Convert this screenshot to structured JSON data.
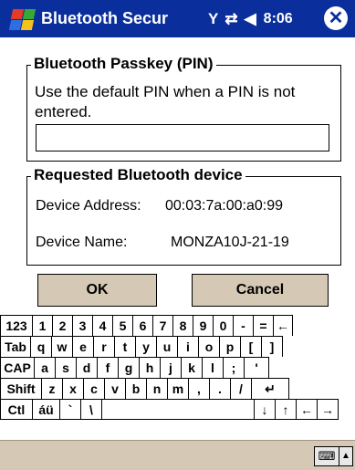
{
  "titlebar": {
    "title": "Bluetooth Secur",
    "status_icons": [
      "signal-icon",
      "connectivity-icon",
      "volume-icon"
    ],
    "signal_glyph": "Y",
    "conn_glyph": "⇄",
    "volume_glyph": "◀",
    "clock": "8:06",
    "close_glyph": "✕"
  },
  "passkey": {
    "legend": "Bluetooth Passkey (PIN)",
    "description": "Use the default PIN when a PIN is not entered.",
    "pin_value": ""
  },
  "device": {
    "legend": "Requested Bluetooth device",
    "address_label": "Device Address:",
    "address_value": "00:03:7a:00:a0:99",
    "name_label": "Device Name:",
    "name_value": "MONZA10J-21-19"
  },
  "buttons": {
    "ok": "OK",
    "cancel": "Cancel"
  },
  "keyboard": {
    "rows": [
      [
        "123",
        "1",
        "2",
        "3",
        "4",
        "5",
        "6",
        "7",
        "8",
        "9",
        "0",
        "-",
        "=",
        "←"
      ],
      [
        "Tab",
        "q",
        "w",
        "e",
        "r",
        "t",
        "y",
        "u",
        "i",
        "o",
        "p",
        "[",
        "]"
      ],
      [
        "CAP",
        "a",
        "s",
        "d",
        "f",
        "g",
        "h",
        "j",
        "k",
        "l",
        ";",
        "'"
      ],
      [
        "Shift",
        "z",
        "x",
        "c",
        "v",
        "b",
        "n",
        "m",
        ",",
        ".",
        "/",
        "↵"
      ],
      [
        "Ctl",
        "áü",
        "`",
        "\\",
        "",
        "↓",
        "↑",
        "←",
        "→"
      ]
    ]
  },
  "bottombar": {
    "sip_glyph": "⌨",
    "sip_arrow": "▲"
  }
}
